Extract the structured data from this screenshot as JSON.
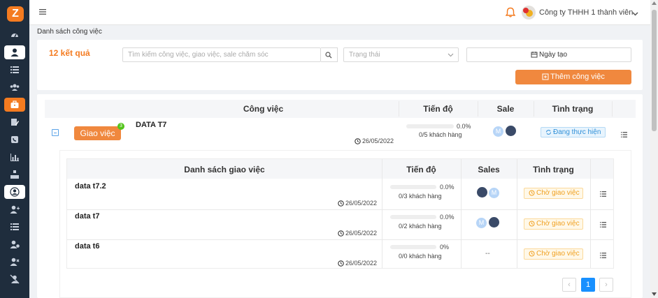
{
  "header": {
    "company": "Công ty THHH 1 thành viên"
  },
  "breadcrumb": "Danh sách công việc",
  "filters": {
    "result_count": "12 kết quả",
    "search_placeholder": "Tìm kiếm công việc, giao việc, sale chăm sóc",
    "status_placeholder": "Trạng thái",
    "date_label": "Ngày tạo",
    "add_button": "Thêm công việc"
  },
  "main_table": {
    "columns": [
      "Công việc",
      "Tiến độ",
      "Sale",
      "Tình trạng"
    ],
    "row": {
      "assign_button": "Giao việc",
      "assign_count": "3",
      "name": "DATA T7",
      "date": "26/05/2022",
      "progress_pct": "0.0%",
      "progress_text": "0/5 khách hàng",
      "sale_avatar_letter": "M",
      "status": "Đang thực hiện"
    }
  },
  "sub_table": {
    "columns": [
      "Danh sách giao việc",
      "Tiến độ",
      "Sales",
      "Tình trạng"
    ],
    "rows": [
      {
        "name": "data t7.2",
        "date": "26/05/2022",
        "progress_pct": "0.0%",
        "progress_text": "0/3 khách hàng",
        "avatar_letter": "M",
        "status": "Chờ giao việc"
      },
      {
        "name": "data t7",
        "date": "26/05/2022",
        "progress_pct": "0.0%",
        "progress_text": "0/2 khách hàng",
        "avatar_letter": "M",
        "status": "Chờ giao việc"
      },
      {
        "name": "data t6",
        "date": "26/05/2022",
        "progress_pct": "0%",
        "progress_text": "0/0 khách hàng",
        "sales_empty": "--",
        "status": "Chờ giao việc"
      }
    ]
  },
  "pagination": {
    "prev": "‹",
    "current": "1",
    "next": "›"
  },
  "colors": {
    "accent": "#f47b20",
    "sidebar": "#1f2d3d",
    "status_blue": "#2f8fd8",
    "status_orange": "#f0a020"
  },
  "icons": [
    "logo-icon",
    "dashboard-icon",
    "user-icon",
    "list-icon",
    "group-icon",
    "briefcase-icon",
    "edit-icon",
    "phone-icon",
    "chart-icon",
    "org-icon",
    "user-circle-icon",
    "user-add-icon",
    "list-icon",
    "user-check-icon",
    "user-remove-icon",
    "user-off-icon",
    "menu-icon",
    "bell-icon",
    "chevron-down-icon",
    "search-icon",
    "calendar-icon",
    "plus-square-icon",
    "clock-icon",
    "sync-icon",
    "kebab-list-icon"
  ]
}
